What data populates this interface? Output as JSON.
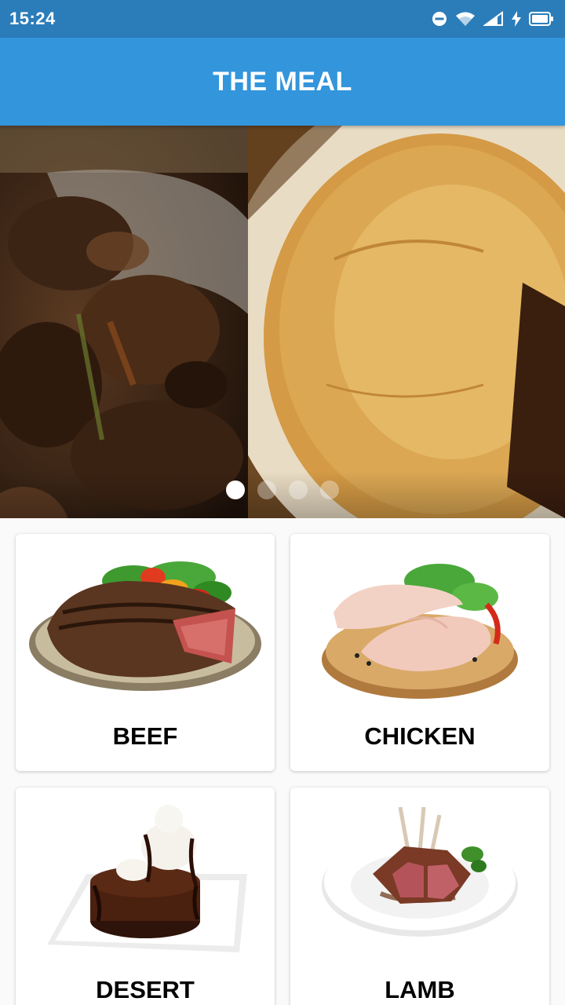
{
  "status_bar": {
    "time": "15:24",
    "icons": [
      "do-not-disturb-icon",
      "wifi-icon",
      "signal-icon",
      "charging-icon",
      "battery-icon"
    ]
  },
  "app_bar": {
    "title": "THE MEAL"
  },
  "carousel": {
    "slide_count": 4,
    "active_index": 0
  },
  "categories": [
    {
      "label": "BEEF"
    },
    {
      "label": "CHICKEN"
    },
    {
      "label": "DESERT"
    },
    {
      "label": "LAMB"
    }
  ],
  "colors": {
    "status_bar": "#2b7dba",
    "app_bar": "#3395db",
    "background": "#fafafa",
    "card": "#ffffff"
  }
}
